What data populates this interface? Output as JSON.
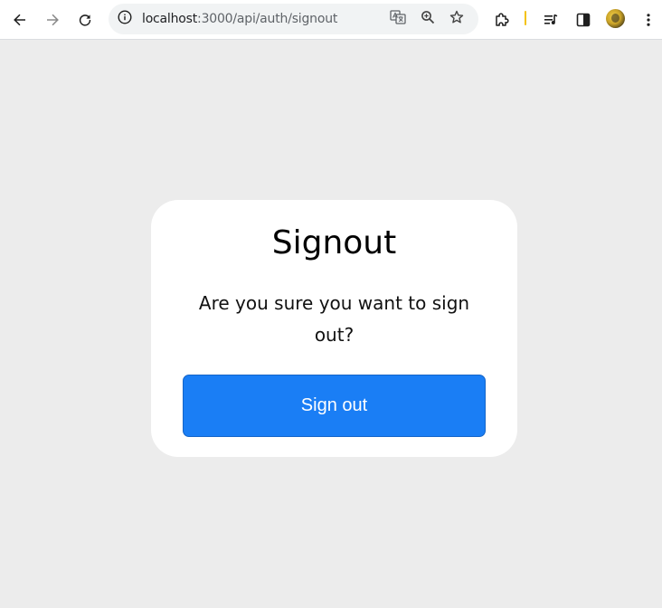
{
  "browser": {
    "url_host": "localhost",
    "url_path": ":3000/api/auth/signout",
    "icons": {
      "back": "back-arrow-icon",
      "forward": "forward-arrow-icon",
      "reload": "reload-icon",
      "site_info": "info-icon",
      "translate": "translate-icon",
      "zoom": "zoom-icon",
      "bookmark": "star-icon",
      "extensions": "puzzle-icon",
      "media": "media-control-icon",
      "side_panel": "side-panel-icon",
      "profile": "avatar",
      "menu": "kebab-menu-icon"
    }
  },
  "signout": {
    "title": "Signout",
    "message": "Are you sure you want to sign out?",
    "button_label": "Sign out"
  },
  "colors": {
    "page_background": "#ececec",
    "card_background": "#ffffff",
    "button_background": "#1a7ef5",
    "button_text": "#ffffff"
  }
}
